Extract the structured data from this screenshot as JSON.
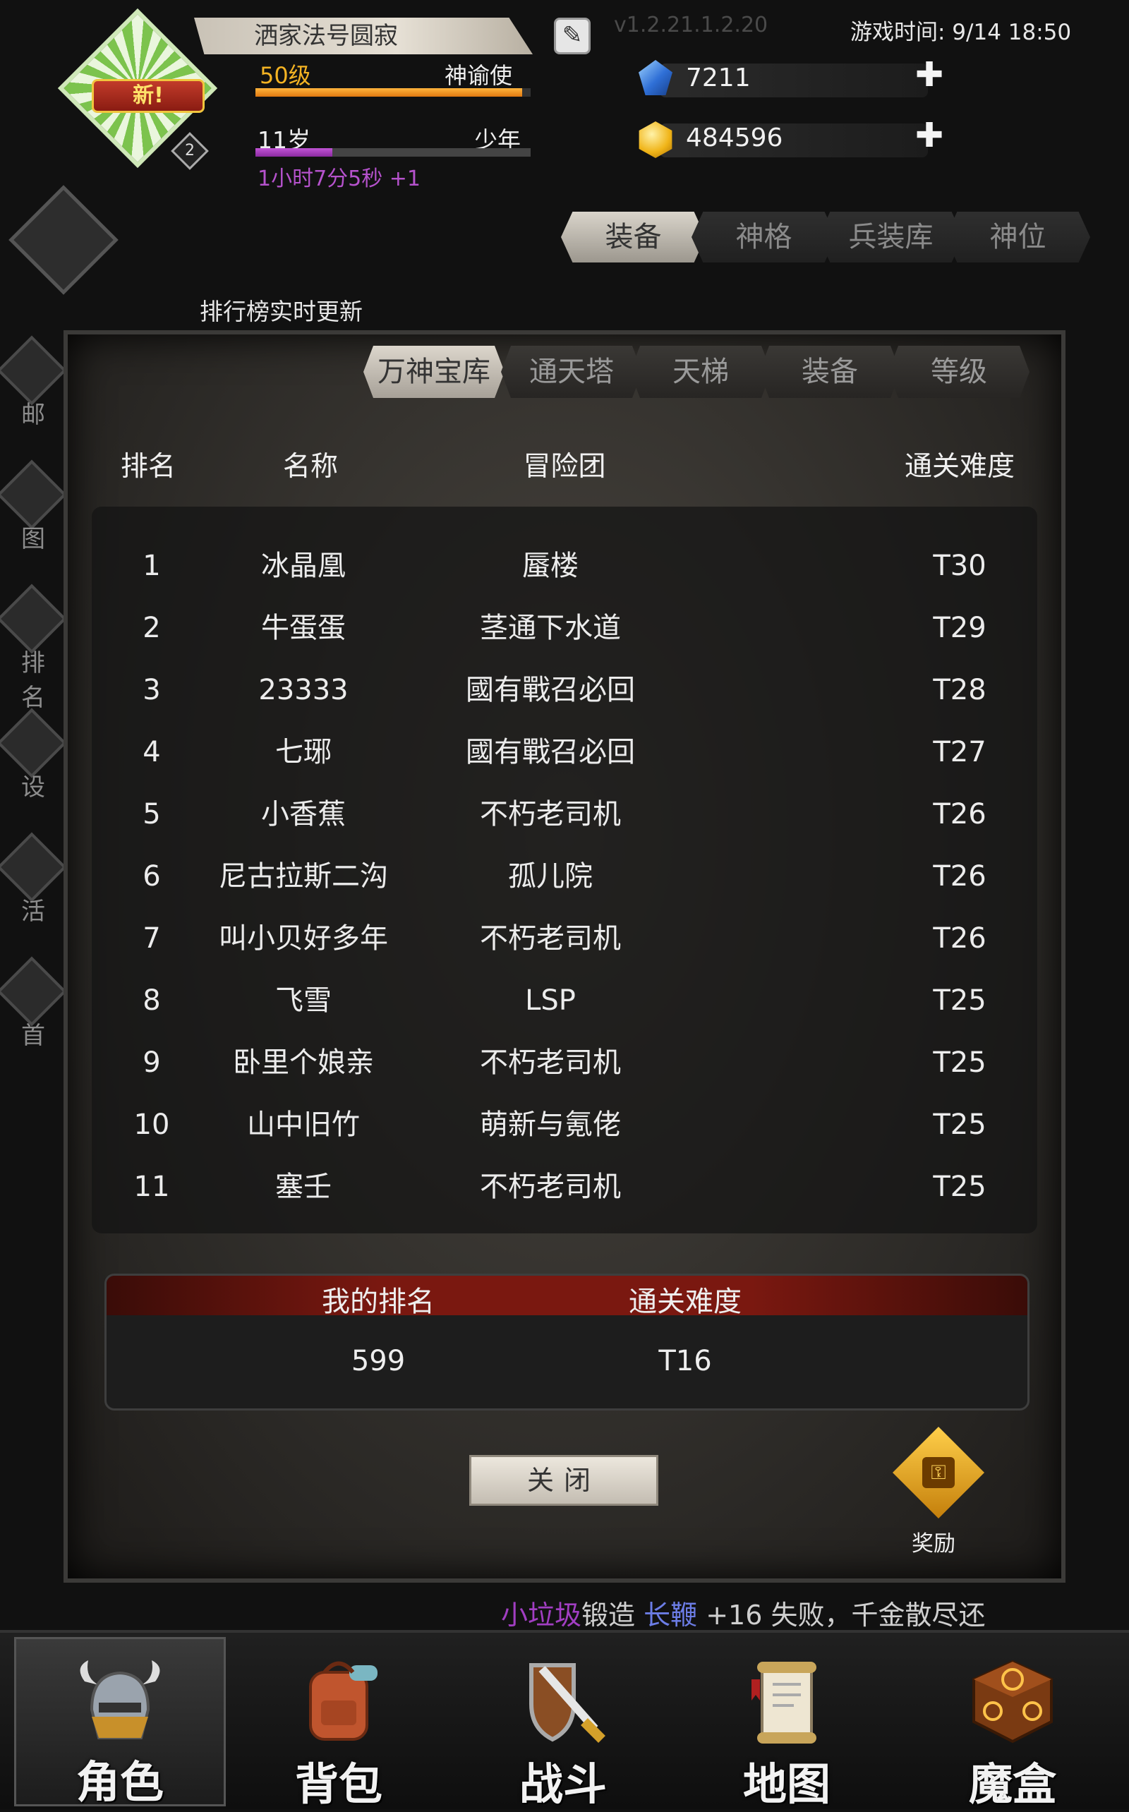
{
  "header": {
    "avatar_badge_text": "新!",
    "avatar_level_badge": "2",
    "player_name": "洒家法号圆寂",
    "level": "50级",
    "title": "神谕使",
    "age": "11岁",
    "age_stage": "少年",
    "timer": "1小时7分5秒 +1",
    "version": "v1.2.21.1.2.20",
    "game_time": "游戏时间: 9/14 18:50",
    "exp_progress": 0.97,
    "age_progress": 0.28
  },
  "currency": {
    "gems": "7211",
    "gold": "484596",
    "plus": "✚"
  },
  "top_tabs": [
    {
      "label": "装备"
    },
    {
      "label": "神格"
    },
    {
      "label": "兵装库"
    },
    {
      "label": "神位"
    }
  ],
  "rank_notice": "排行榜实时更新",
  "side_menu": [
    {
      "label": "邮"
    },
    {
      "label": "图"
    },
    {
      "label": "排名"
    },
    {
      "label": "设"
    },
    {
      "label": "活"
    },
    {
      "label": "首"
    }
  ],
  "panel_tabs": [
    {
      "label": "万神宝库"
    },
    {
      "label": "通天塔"
    },
    {
      "label": "天梯"
    },
    {
      "label": "装备"
    },
    {
      "label": "等级"
    }
  ],
  "table": {
    "headers": {
      "rank": "排名",
      "name": "名称",
      "team": "冒险团",
      "difficulty": "通关难度"
    },
    "rows": [
      {
        "rank": "1",
        "name": "冰晶凰",
        "team": "蜃楼",
        "difficulty": "T30"
      },
      {
        "rank": "2",
        "name": "牛蛋蛋",
        "team": "茎通下水道",
        "difficulty": "T29"
      },
      {
        "rank": "3",
        "name": "23333",
        "team": "國有戰召必回",
        "difficulty": "T28"
      },
      {
        "rank": "4",
        "name": "七琊",
        "team": "國有戰召必回",
        "difficulty": "T27"
      },
      {
        "rank": "5",
        "name": "小香蕉",
        "team": "不朽老司机",
        "difficulty": "T26"
      },
      {
        "rank": "6",
        "name": "尼古拉斯二沟",
        "team": "孤儿院",
        "difficulty": "T26"
      },
      {
        "rank": "7",
        "name": "叫小贝好多年",
        "team": "不朽老司机",
        "difficulty": "T26"
      },
      {
        "rank": "8",
        "name": "飞雪",
        "team": "LSP",
        "difficulty": "T25"
      },
      {
        "rank": "9",
        "name": "卧里个娘亲",
        "team": "不朽老司机",
        "difficulty": "T25"
      },
      {
        "rank": "10",
        "name": "山中旧竹",
        "team": "萌新与氪佬",
        "difficulty": "T25"
      },
      {
        "rank": "11",
        "name": "塞壬",
        "team": "不朽老司机",
        "difficulty": "T25"
      }
    ]
  },
  "my_rank": {
    "rank_label": "我的排名",
    "difficulty_label": "通关难度",
    "rank_value": "599",
    "difficulty_value": "T16"
  },
  "close_label": "关闭",
  "reward_label": "奖励",
  "ticker": {
    "player": "小垃圾",
    "action": "锻造",
    "item": "长鞭",
    "rest": " +16 失败，千金散尽还"
  },
  "bottom_nav": [
    {
      "label": "角色",
      "icon": "helmet-icon"
    },
    {
      "label": "背包",
      "icon": "backpack-icon"
    },
    {
      "label": "战斗",
      "icon": "sword-shield-icon"
    },
    {
      "label": "地图",
      "icon": "scroll-map-icon"
    },
    {
      "label": "魔盒",
      "icon": "magic-box-icon"
    }
  ],
  "colors": {
    "level": "#f4b323",
    "timer": "#b552cc",
    "ticker_player": "#a13ec2",
    "ticker_item": "#6c7de6"
  }
}
